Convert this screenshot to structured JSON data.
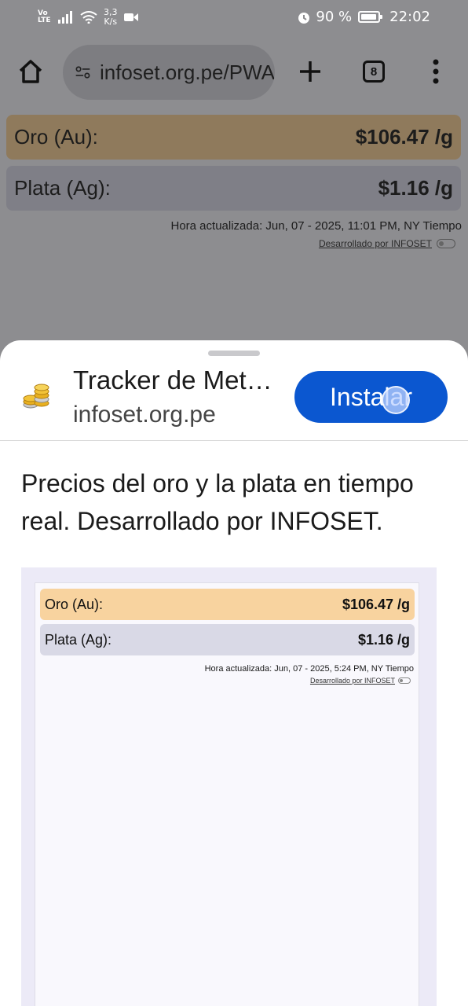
{
  "status_bar": {
    "volte_top": "Vo",
    "volte_bottom": "LTE",
    "speed_value": "3,3",
    "speed_unit": "K/s",
    "battery_percent": "90 %",
    "time": "22:02"
  },
  "browser": {
    "url": "infoset.org.pe/PWA",
    "tab_count": "8"
  },
  "background_page": {
    "gold_label": "Oro (Au):",
    "gold_value": "$106.47 /g",
    "silver_label": "Plata (Ag):",
    "silver_value": "$1.16 /g",
    "updated_text": "Hora actualizada: Jun, 07 - 2025, 11:01 PM, NY Tiempo",
    "developed_by": "Desarrollado por INFOSET"
  },
  "install_sheet": {
    "app_name": "Tracker de Metales Preciosos",
    "app_domain": "infoset.org.pe",
    "install_label": "Instalar",
    "description": "Precios del oro y la plata en tiempo real. Desarrollado por INFOSET."
  },
  "preview": {
    "gold_label": "Oro (Au):",
    "gold_value": "$106.47 /g",
    "silver_label": "Plata (Ag):",
    "silver_value": "$1.16 /g",
    "updated_text": "Hora actualizada: Jun, 07 - 2025, 5:24 PM, NY Tiempo",
    "developed_by": "Desarrollado por INFOSET"
  },
  "colors": {
    "install_button": "#0b57d0",
    "gold_row": "#f8d39f",
    "silver_row": "#d9d9e6"
  },
  "icons": [
    "volte-icon",
    "signal-icon",
    "wifi-icon",
    "video-camera-icon",
    "alarm-icon",
    "battery-icon",
    "home-icon",
    "site-settings-icon",
    "plus-icon",
    "tabs-icon",
    "more-vert-icon",
    "gold-coins-icon"
  ]
}
